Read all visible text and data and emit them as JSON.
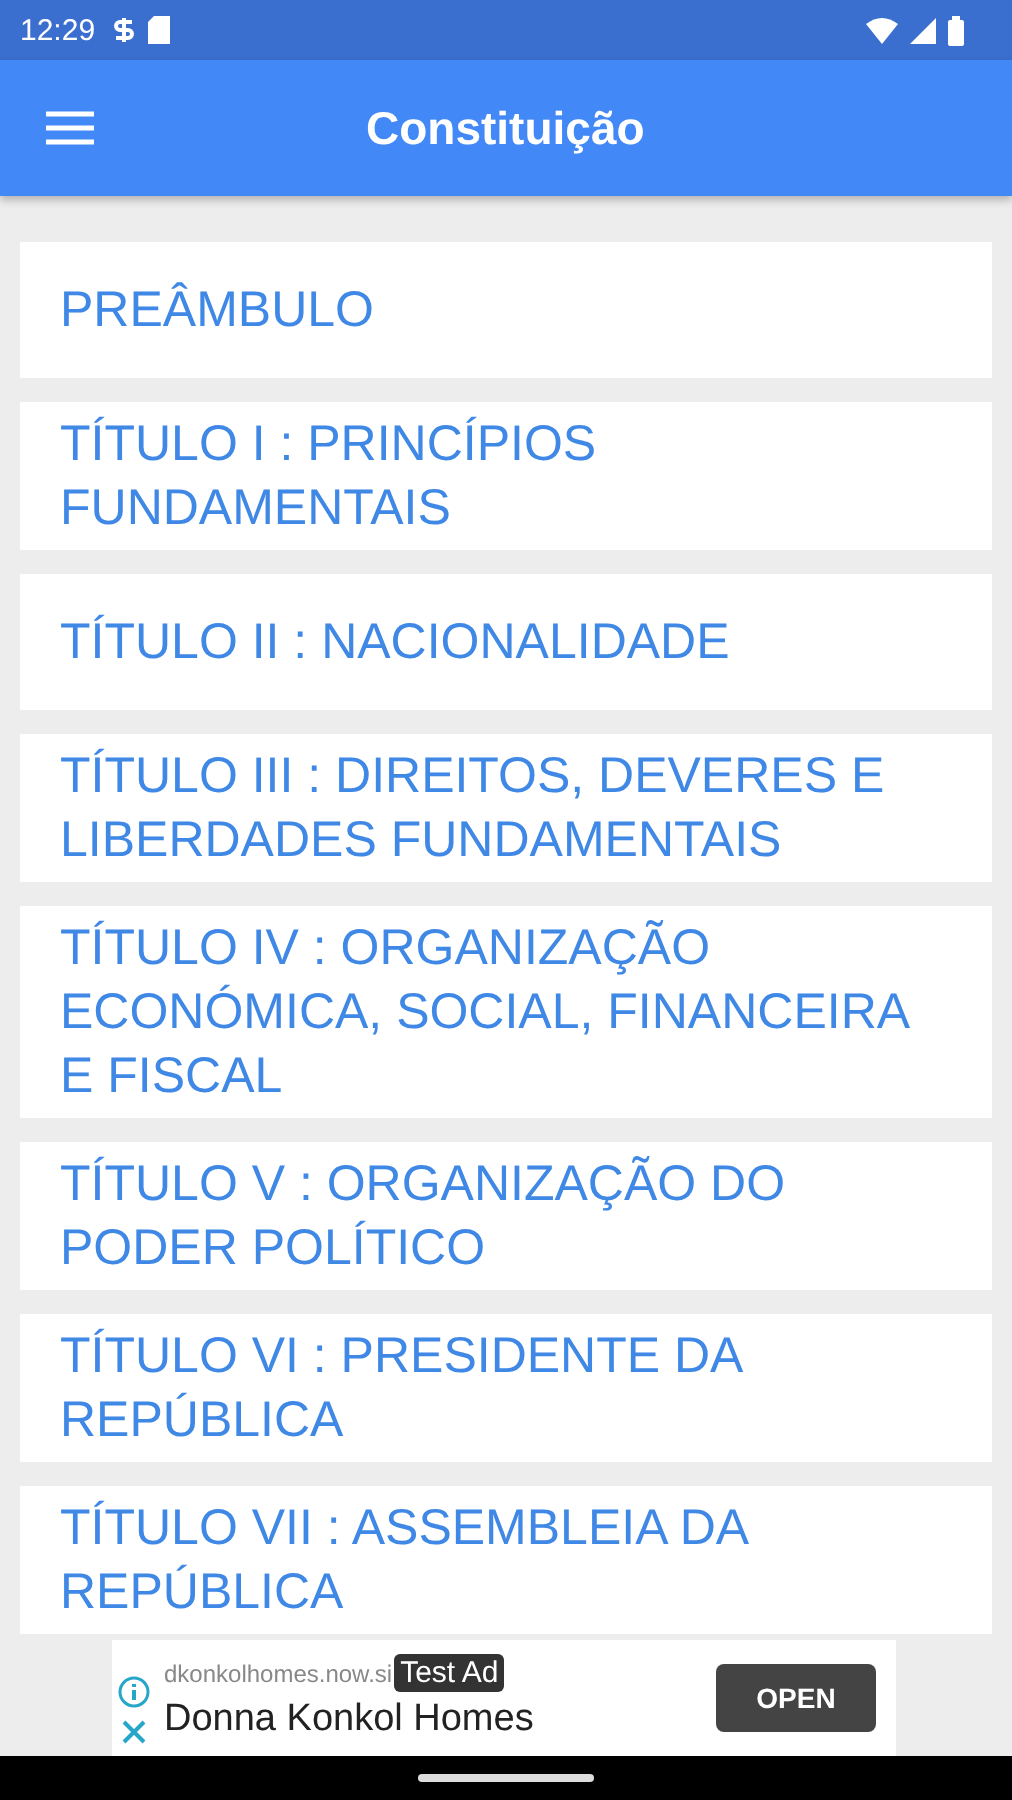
{
  "status_bar": {
    "time": "12:29"
  },
  "app_bar": {
    "title": "Constituição"
  },
  "items": [
    {
      "label": "PREÂMBULO"
    },
    {
      "label": "TÍTULO I : PRINCÍPIOS FUNDAMENTAIS"
    },
    {
      "label": "TÍTULO II : NACIONALIDADE"
    },
    {
      "label": "TÍTULO III : DIREITOS, DEVERES E LIBERDADES FUNDAMENTAIS"
    },
    {
      "label": "TÍTULO IV : ORGANIZAÇÃO ECONÓMICA, SOCIAL, FINANCEIRA E FISCAL"
    },
    {
      "label": "TÍTULO V : ORGANIZAÇÃO DO PODER POLÍTICO"
    },
    {
      "label": "TÍTULO VI : PRESIDENTE DA REPÚBLICA"
    },
    {
      "label": "TÍTULO VII : ASSEMBLEIA DA REPÚBLICA"
    }
  ],
  "ad": {
    "url": "dkonkolhomes.now.si",
    "badge": "Test Ad",
    "title": "Donna Konkol Homes",
    "button": "OPEN"
  }
}
